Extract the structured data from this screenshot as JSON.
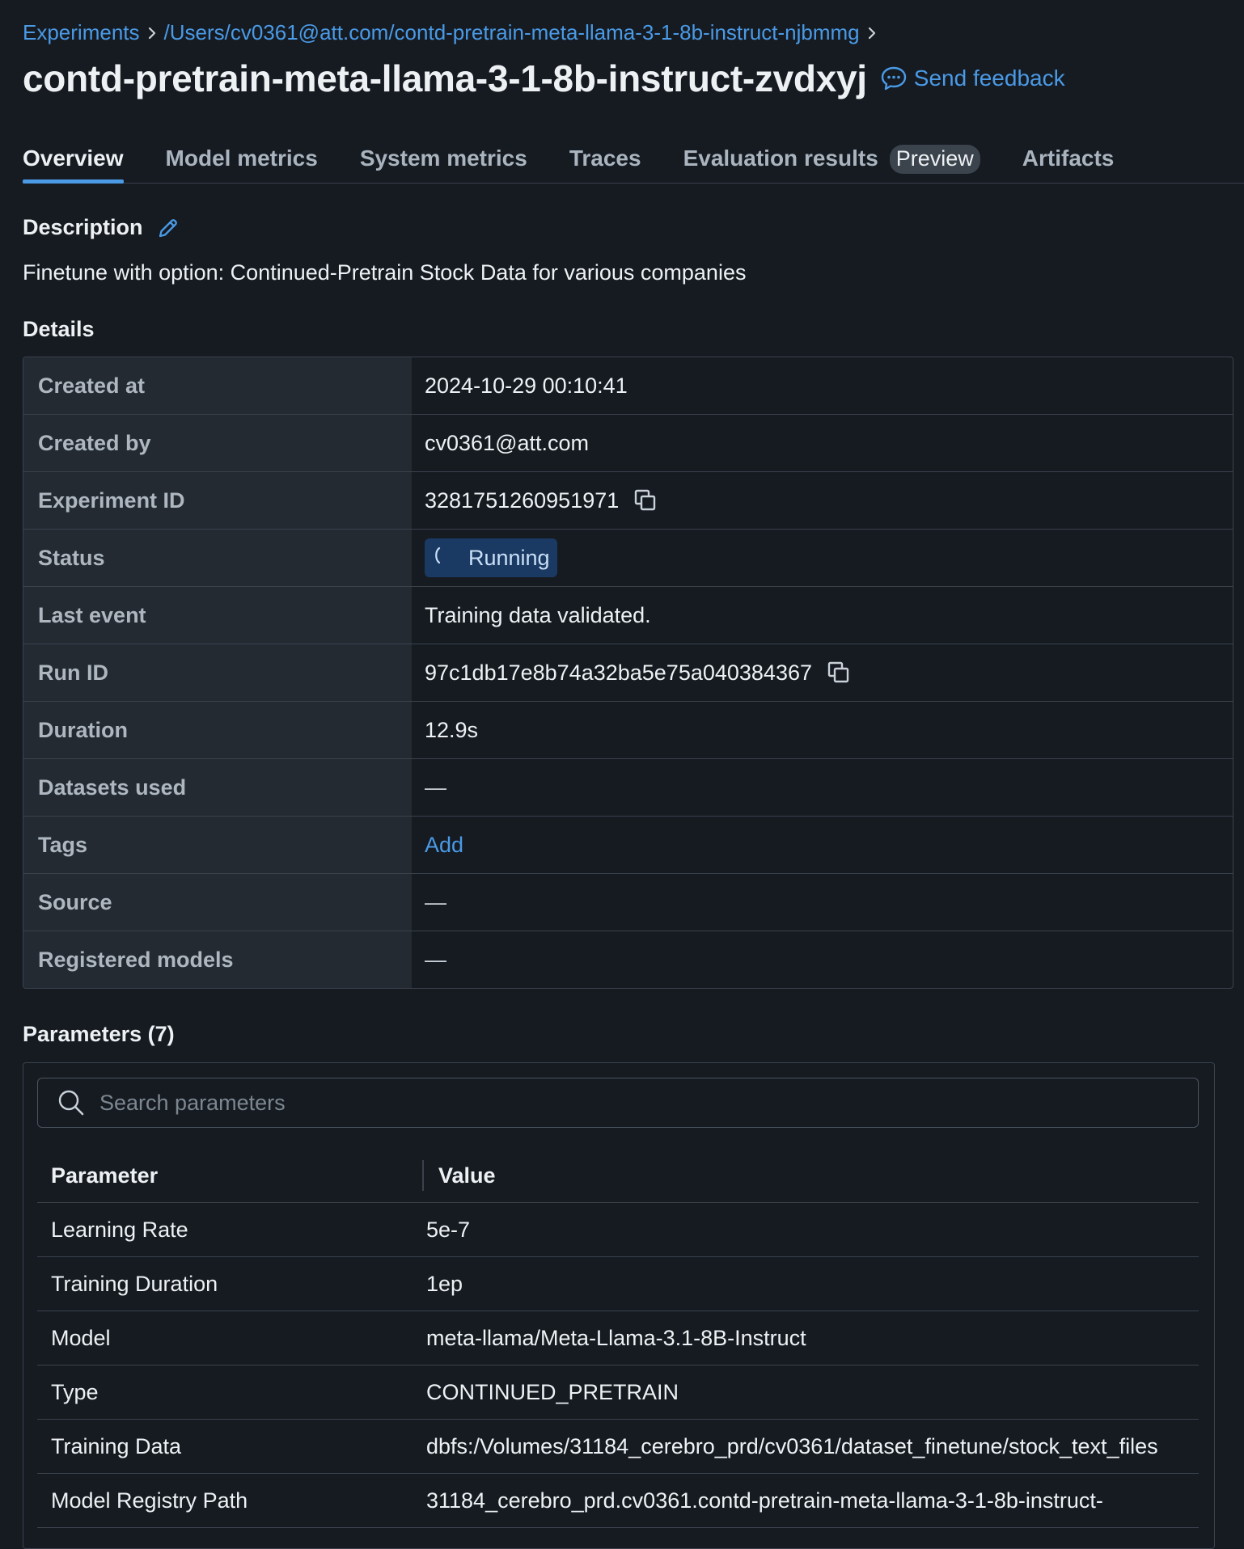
{
  "breadcrumb": {
    "items": [
      "Experiments",
      "/Users/cv0361@att.com/contd-pretrain-meta-llama-3-1-8b-instruct-njbmmg"
    ]
  },
  "header": {
    "title": "contd-pretrain-meta-llama-3-1-8b-instruct-zvdxyj",
    "feedback_label": "Send feedback"
  },
  "tabs": [
    {
      "label": "Overview",
      "active": true
    },
    {
      "label": "Model metrics"
    },
    {
      "label": "System metrics"
    },
    {
      "label": "Traces"
    },
    {
      "label": "Evaluation results",
      "badge": "Preview"
    },
    {
      "label": "Artifacts"
    }
  ],
  "description": {
    "heading": "Description",
    "text": "Finetune with option: Continued-Pretrain Stock Data for various companies"
  },
  "details": {
    "heading": "Details",
    "rows": [
      {
        "key": "Created at",
        "value": "2024-10-29 00:10:41"
      },
      {
        "key": "Created by",
        "value": "cv0361@att.com"
      },
      {
        "key": "Experiment ID",
        "value": "3281751260951971"
      },
      {
        "key": "Status",
        "value": "Running"
      },
      {
        "key": "Last event",
        "value": "Training data validated."
      },
      {
        "key": "Run ID",
        "value": "97c1db17e8b74a32ba5e75a040384367"
      },
      {
        "key": "Duration",
        "value": "12.9s"
      },
      {
        "key": "Datasets used",
        "value": "—"
      },
      {
        "key": "Tags",
        "value": "Add"
      },
      {
        "key": "Source",
        "value": "—"
      },
      {
        "key": "Registered models",
        "value": "—"
      }
    ]
  },
  "parameters": {
    "heading": "Parameters (7)",
    "search_placeholder": "Search parameters",
    "columns": [
      "Parameter",
      "Value"
    ],
    "rows": [
      {
        "name": "Learning Rate",
        "value": "5e-7"
      },
      {
        "name": "Training Duration",
        "value": "1ep"
      },
      {
        "name": "Model",
        "value": "meta-llama/Meta-Llama-3.1-8B-Instruct"
      },
      {
        "name": "Type",
        "value": "CONTINUED_PRETRAIN"
      },
      {
        "name": "Training Data",
        "value": "dbfs:/Volumes/31184_cerebro_prd/cv0361/dataset_finetune/stock_text_files"
      },
      {
        "name": "Model Registry Path",
        "value": "31184_cerebro_prd.cv0361.contd-pretrain-meta-llama-3-1-8b-instruct-"
      }
    ]
  },
  "colors": {
    "background": "#161b22",
    "link": "#4a9ae6",
    "status_running_bg": "#1b3a63"
  },
  "icons": {
    "breadcrumb_separator": "chevron-right-icon",
    "feedback": "speech-bubble-icon",
    "edit": "pencil-icon",
    "copy": "copy-icon",
    "status": "spinner-icon",
    "search": "search-icon"
  }
}
